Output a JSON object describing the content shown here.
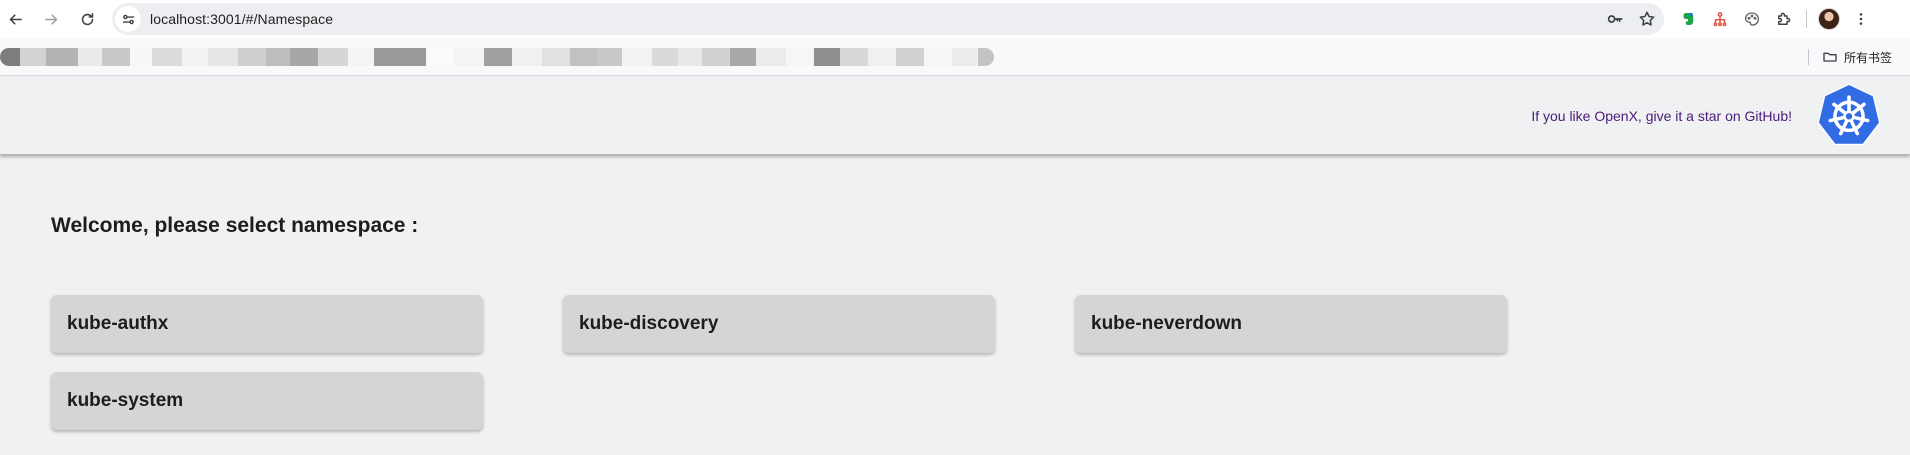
{
  "browser": {
    "url": "localhost:3001/#/Namespace",
    "icons": {
      "back": "arrow-left-icon",
      "forward": "arrow-right-icon",
      "reload": "reload-icon",
      "site_info": "tune-icon",
      "password": "key-icon",
      "bookmark_star": "star-icon",
      "extensions": "puzzle-icon",
      "menu": "vertical-dots-icon"
    },
    "extensions": [
      "evernote-extension",
      "red-extension",
      "gray-extension"
    ]
  },
  "bookmarks_bar": {
    "all_bookmarks_label": "所有书签"
  },
  "header": {
    "github_text": "If you like OpenX, give it a star on GitHub!",
    "logo": "kubernetes-logo",
    "accent_color": "#326ce5",
    "link_color": "#4b1b7a"
  },
  "main": {
    "welcome_text": "Welcome, please select namespace :",
    "namespaces": [
      {
        "label": "kube-authx"
      },
      {
        "label": "kube-discovery"
      },
      {
        "label": "kube-neverdown"
      },
      {
        "label": "kube-system"
      }
    ]
  }
}
